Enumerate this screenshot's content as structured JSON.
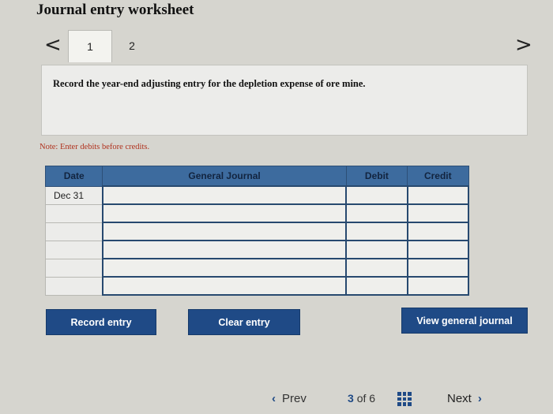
{
  "header": {
    "title": "Journal entry worksheet"
  },
  "nav": {
    "prev_arrow": "<",
    "next_arrow": ">"
  },
  "tabs": [
    {
      "label": "1"
    },
    {
      "label": "2"
    }
  ],
  "prompt": {
    "text": "Record the year-end adjusting entry for the depletion expense of ore mine."
  },
  "note": "Note: Enter debits before credits.",
  "journal": {
    "columns": [
      "Date",
      "General Journal",
      "Debit",
      "Credit"
    ],
    "rows": [
      {
        "date": "Dec 31",
        "account": "",
        "debit": "",
        "credit": ""
      },
      {
        "date": "",
        "account": "",
        "debit": "",
        "credit": ""
      },
      {
        "date": "",
        "account": "",
        "debit": "",
        "credit": ""
      },
      {
        "date": "",
        "account": "",
        "debit": "",
        "credit": ""
      },
      {
        "date": "",
        "account": "",
        "debit": "",
        "credit": ""
      },
      {
        "date": "",
        "account": "",
        "debit": "",
        "credit": ""
      }
    ]
  },
  "buttons": {
    "record": "Record entry",
    "clear": "Clear entry",
    "view": "View general journal"
  },
  "footer": {
    "prev_label": "Prev",
    "page_current": "3",
    "page_of": "of",
    "page_total": "6",
    "next_label": "Next"
  },
  "icons": {
    "prev_chevron": "chevron-left-icon",
    "next_chevron": "chevron-right-icon",
    "grid": "grid-icon"
  },
  "colors": {
    "header_blue": "#3d6b9e",
    "button_blue": "#1f4a86",
    "note_red": "#b0321e"
  }
}
